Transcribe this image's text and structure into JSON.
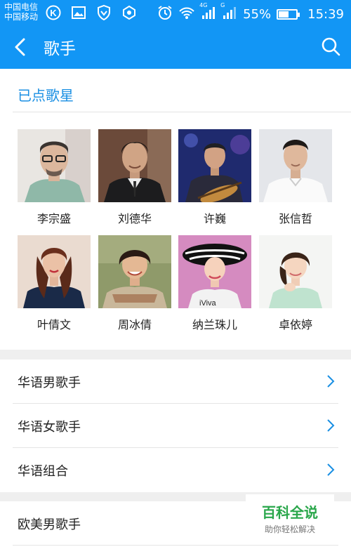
{
  "status_bar": {
    "carrier1": "中国电信",
    "carrier2": "中国移动",
    "battery": "55%",
    "time": "15:39",
    "net1": "4G",
    "net2": "G",
    "battery_level": 0.55,
    "icons": [
      "k-app-icon",
      "image-icon",
      "vpn-shield-icon",
      "app-icon",
      "alarm-icon",
      "wifi-icon",
      "signal-icon"
    ]
  },
  "header": {
    "title": "歌手",
    "back_icon": "back-arrow-icon",
    "search_icon": "search-icon"
  },
  "favorites": {
    "title": "已点歌星",
    "singers": [
      {
        "name": "李宗盛"
      },
      {
        "name": "刘德华"
      },
      {
        "name": "许巍"
      },
      {
        "name": "张信哲"
      },
      {
        "name": "叶倩文"
      },
      {
        "name": "周冰倩"
      },
      {
        "name": "纳兰珠儿"
      },
      {
        "name": "卓依婷"
      }
    ]
  },
  "categories": [
    {
      "label": "华语男歌手"
    },
    {
      "label": "华语女歌手"
    },
    {
      "label": "华语组合"
    }
  ],
  "categories2": [
    {
      "label": "欧美男歌手"
    }
  ],
  "watermark": {
    "main": "百科全说",
    "sub": "助你轻松解决"
  },
  "colors": {
    "primary": "#1296f5",
    "accent_text": "#1a8fe3",
    "watermark_green": "#2aa74b"
  }
}
